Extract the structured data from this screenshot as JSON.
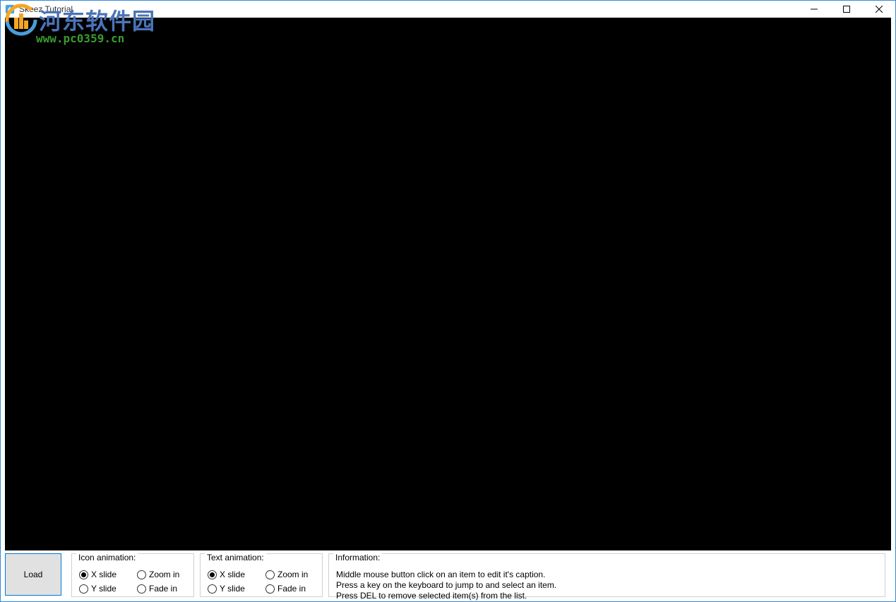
{
  "window": {
    "title": "Skeez Tutorial"
  },
  "watermark": {
    "cn_text": "河东软件园",
    "url": "www.pc0359.cn"
  },
  "bottom": {
    "load_label": "Load",
    "icon_animation": {
      "legend": "Icon animation:",
      "options": [
        {
          "label": "X slide",
          "selected": true
        },
        {
          "label": "Zoom in",
          "selected": false
        },
        {
          "label": "Y slide",
          "selected": false
        },
        {
          "label": "Fade in",
          "selected": false
        }
      ]
    },
    "text_animation": {
      "legend": "Text animation:",
      "options": [
        {
          "label": "X slide",
          "selected": true
        },
        {
          "label": "Zoom in",
          "selected": false
        },
        {
          "label": "Y slide",
          "selected": false
        },
        {
          "label": "Fade in",
          "selected": false
        }
      ]
    },
    "information": {
      "legend": "Information:",
      "lines": [
        "Middle mouse button click on an item to edit it's caption.",
        "Press a key on the keyboard to jump to and select an item.",
        "Press DEL to remove selected item(s) from the list."
      ]
    }
  }
}
